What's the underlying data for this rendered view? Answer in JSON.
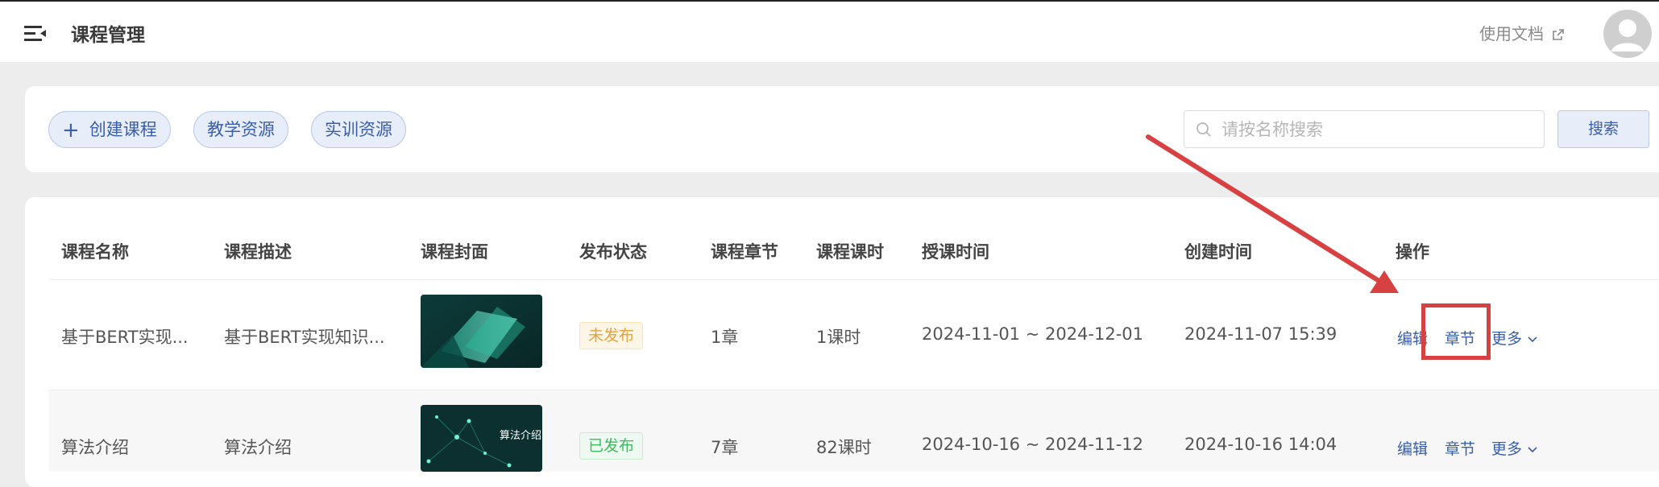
{
  "header": {
    "title": "课程管理",
    "doc_link": "使用文档"
  },
  "toolbar": {
    "create_course": "创建课程",
    "teaching_resources": "教学资源",
    "training_resources": "实训资源",
    "search_placeholder": "请按名称搜索",
    "search_button": "搜索"
  },
  "table": {
    "columns": [
      "课程名称",
      "课程描述",
      "课程封面",
      "发布状态",
      "课程章节",
      "课程课时",
      "授课时间",
      "创建时间",
      "操作"
    ],
    "rows": [
      {
        "name": "基于BERT实现...",
        "description": "基于BERT实现知识...",
        "cover_text": "",
        "status": "未发布",
        "chapters": "1章",
        "hours": "1课时",
        "teaching_time": "2024-11-01 ~ 2024-12-01",
        "created_time": "2024-11-07 15:39",
        "ops": {
          "edit": "编辑",
          "chapter": "章节",
          "more": "更多"
        }
      },
      {
        "name": "算法介绍",
        "description": "算法介绍",
        "cover_text": "算法介绍",
        "status": "已发布",
        "chapters": "7章",
        "hours": "82课时",
        "teaching_time": "2024-10-16 ~ 2024-11-12",
        "created_time": "2024-10-16 14:04",
        "ops": {
          "edit": "编辑",
          "chapter": "章节",
          "more": "更多"
        }
      }
    ]
  },
  "colors": {
    "accent": "#3a5ea8",
    "annotation": "#d84141",
    "unpublished": "#e6a23c",
    "published": "#3fba5f"
  },
  "icons": [
    "menu-fold-icon",
    "external-link-icon",
    "user-avatar-icon",
    "plus-icon",
    "search-icon",
    "chevron-down-icon"
  ]
}
